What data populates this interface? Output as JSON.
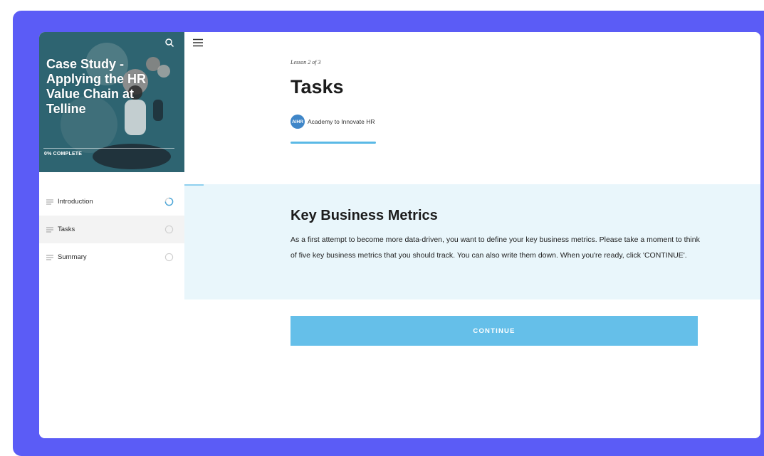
{
  "course": {
    "title": "Case Study - Applying the HR Value Chain at Telline",
    "progress_text": "0% COMPLETE"
  },
  "sidebar": {
    "items": [
      {
        "label": "Introduction",
        "status": "in-progress"
      },
      {
        "label": "Tasks",
        "status": "active"
      },
      {
        "label": "Summary",
        "status": "not-started"
      }
    ]
  },
  "lesson": {
    "counter": "Lesson 2 of 3",
    "title": "Tasks",
    "author_logo": "AIHR",
    "author": "Academy to Innovate HR"
  },
  "section": {
    "heading": "Key Business Metrics",
    "body": "As a first attempt to become more data-driven, you want to define your key business metrics. Please take a moment to think of five key business metrics that you should track. You can also write them down. When you're ready, click 'CONTINUE'."
  },
  "continue_label": "CONTINUE",
  "colors": {
    "frame": "#5b5cf6",
    "hero": "#2e6471",
    "accent": "#65bfe9",
    "section_bg": "#e9f6fb"
  }
}
